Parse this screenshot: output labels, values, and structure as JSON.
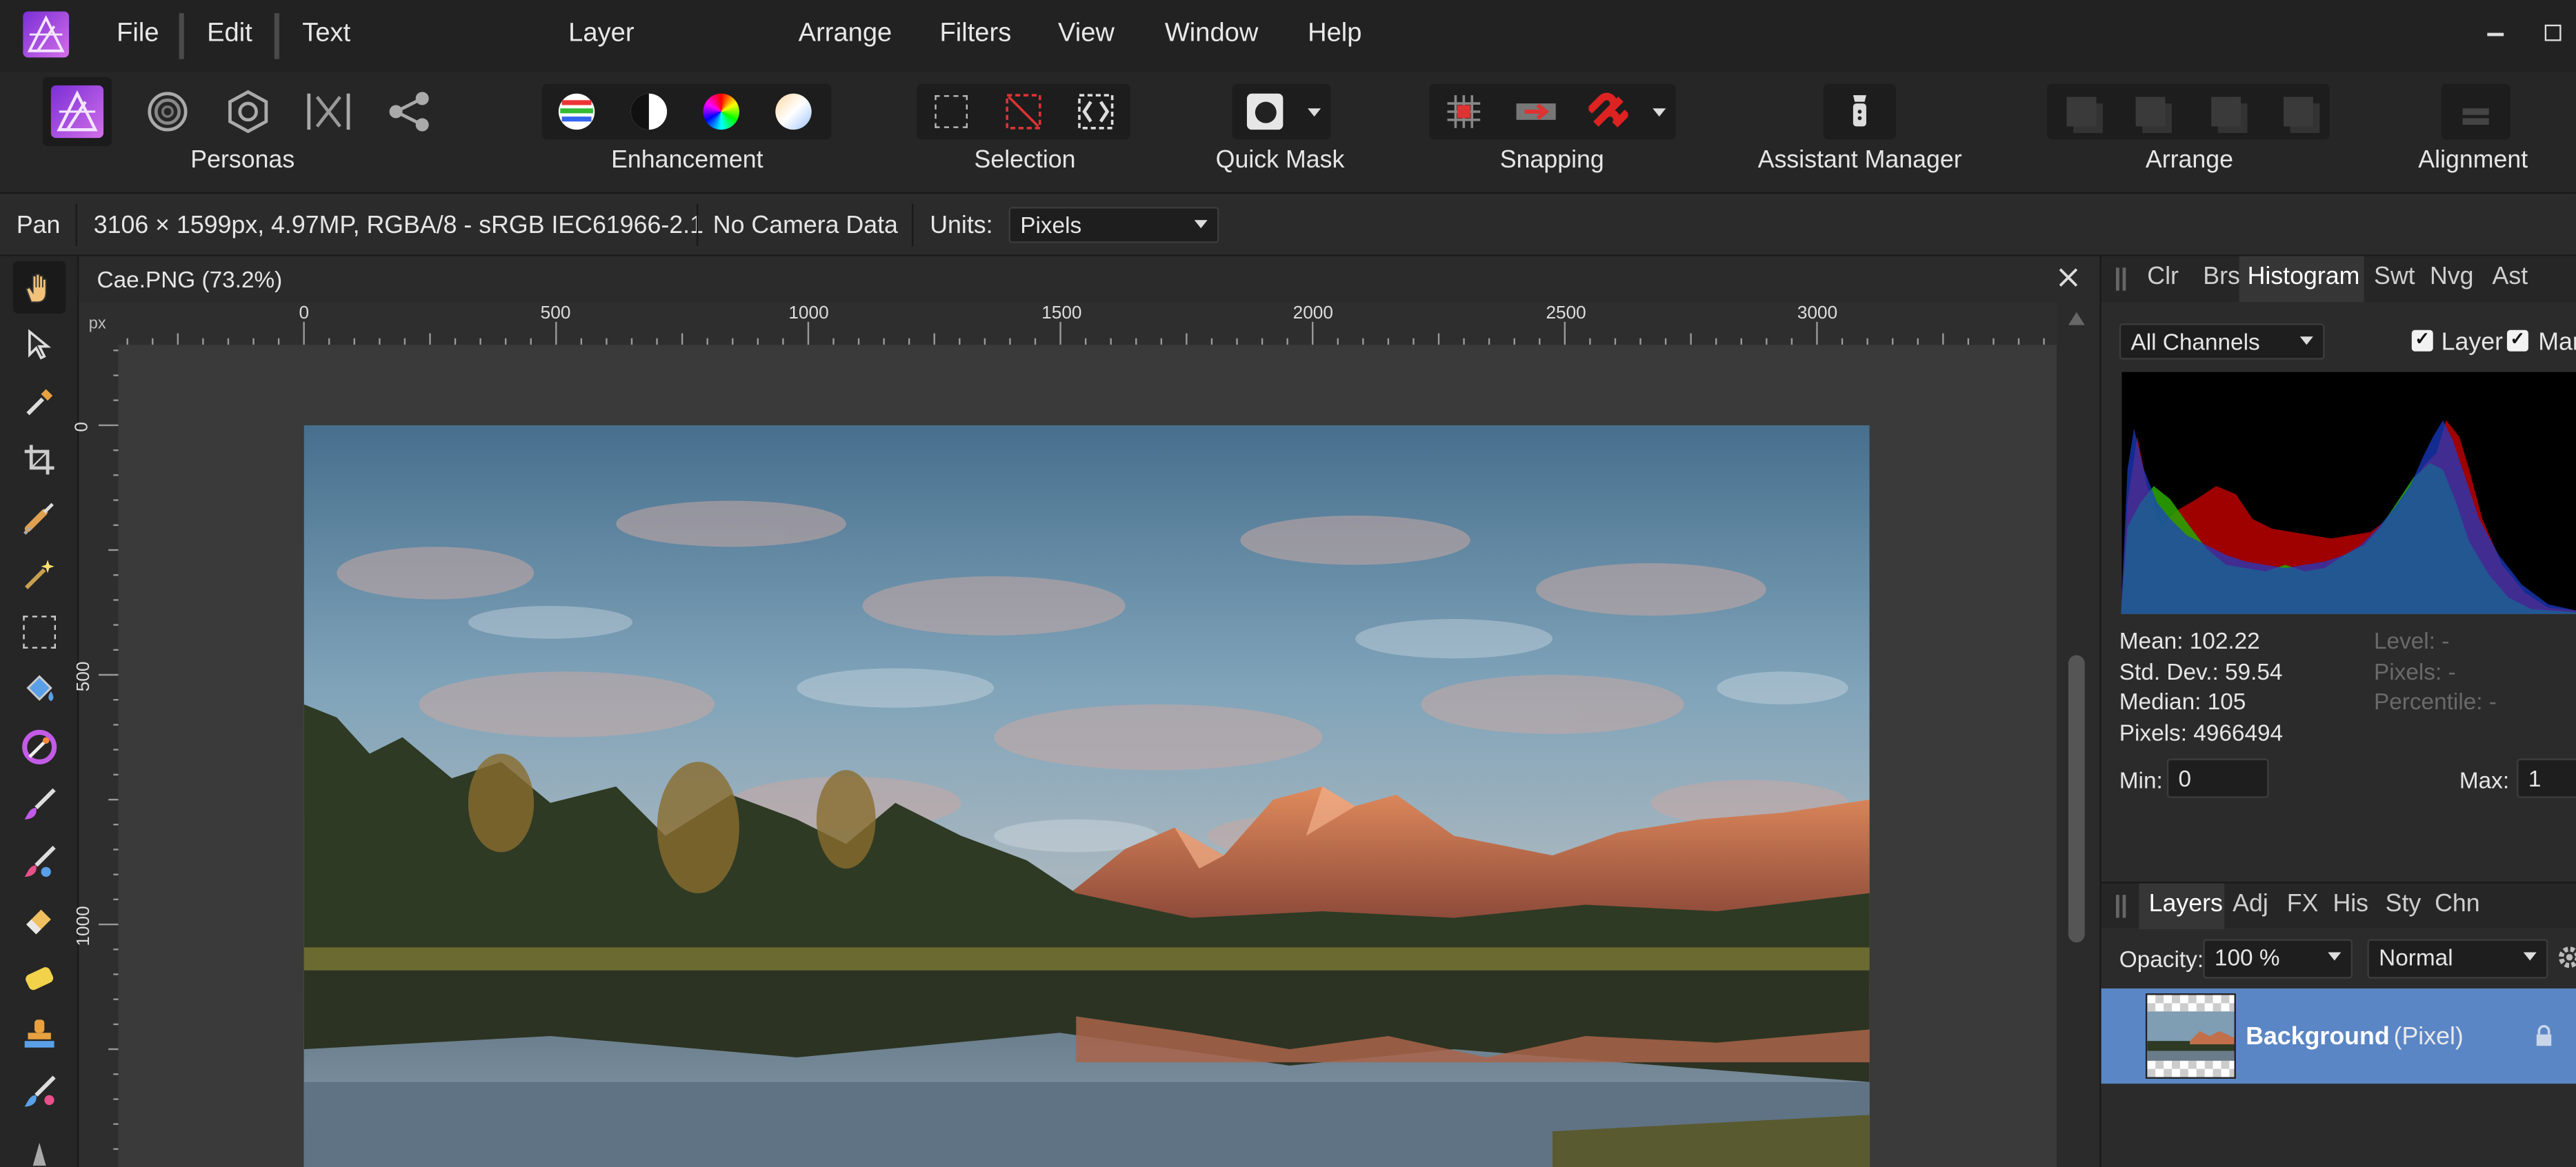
{
  "menu": {
    "file": "File",
    "edit": "Edit",
    "text": "Text",
    "layer": "Layer",
    "arrange": "Arrange",
    "filters": "Filters",
    "view": "View",
    "window": "Window",
    "help": "Help"
  },
  "toolbar": {
    "personas": "Personas",
    "enhancement": "Enhancement",
    "selection": "Selection",
    "quick_mask": "Quick Mask",
    "snapping": "Snapping",
    "assistant_manager": "Assistant Manager",
    "arrange": "Arrange",
    "alignment": "Alignment"
  },
  "context": {
    "tool": "Pan",
    "image_info": "3106 × 1599px, 4.97MP, RGBA/8 - sRGB IEC61966-2.1",
    "camera": "No Camera Data",
    "units_label": "Units:",
    "units_value": "Pixels"
  },
  "document": {
    "tab_title": "Cae.PNG (73.2%)"
  },
  "ruler": {
    "unit": "px",
    "h_ticks": [
      "0",
      "500",
      "1000",
      "1500",
      "2000",
      "2500",
      "3000"
    ],
    "v_ticks": [
      "0",
      "500",
      "1000"
    ]
  },
  "panel_tabs_top": [
    "Clr",
    "Brs",
    "Histogram",
    "Swt",
    "Nvg",
    "Ast"
  ],
  "histogram": {
    "channel": "All Channels",
    "layer_label": "Layer",
    "marquee_label": "Mar",
    "layer_checked": true,
    "marquee_checked": true,
    "mean": "Mean: 102.22",
    "stddev": "Std. Dev.: 59.54",
    "median": "Median: 105",
    "pixels": "Pixels: 4966494",
    "level": "Level: -",
    "pixels_r": "Pixels: -",
    "percentile": "Percentile: -",
    "min_label": "Min:",
    "min_value": "0",
    "max_label": "Max:",
    "max_value": "1"
  },
  "panel_tabs_bottom": [
    "Layers",
    "Adj",
    "FX",
    "His",
    "Sty",
    "Chn"
  ],
  "layers": {
    "opacity_label": "Opacity:",
    "opacity_value": "100 %",
    "blend_mode": "Normal",
    "items": [
      {
        "name": "Background",
        "type": "(Pixel)",
        "locked": true
      }
    ]
  },
  "colors": {
    "accent": "#b35be8",
    "layer_selected": "#5b86c5",
    "chrome": "#2b2b2b"
  }
}
